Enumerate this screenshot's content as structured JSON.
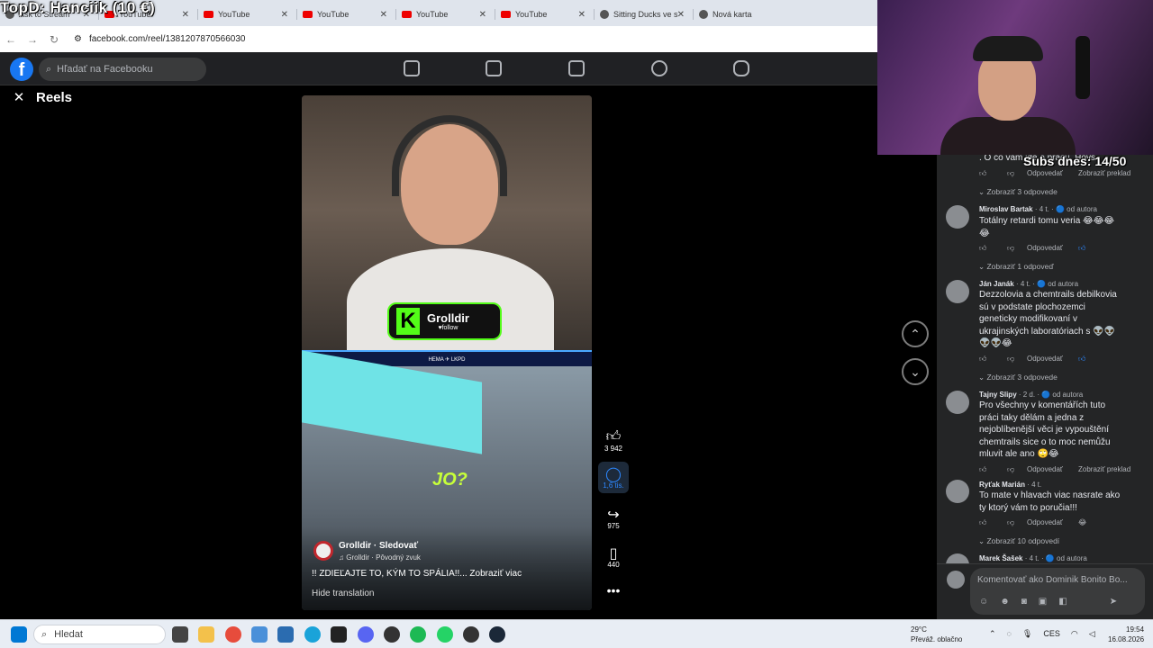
{
  "overlay_title": "TopD: Hanciik (10 €)",
  "tabs": [
    {
      "label": "Ask to Stream",
      "icon": "generic-icon"
    },
    {
      "label": "YouTube",
      "icon": "youtube-icon"
    },
    {
      "label": "YouTube",
      "icon": "youtube-icon"
    },
    {
      "label": "YouTube",
      "icon": "youtube-icon"
    },
    {
      "label": "YouTube",
      "icon": "youtube-icon"
    },
    {
      "label": "YouTube",
      "icon": "youtube-icon"
    },
    {
      "label": "Sitting Ducks ve s",
      "icon": "steam-icon"
    },
    {
      "label": "Nová karta",
      "icon": "chrome-icon"
    }
  ],
  "address": {
    "url": "facebook.com/reel/1381207870566030"
  },
  "facebook": {
    "search_placeholder": "Hľadať na Facebooku",
    "reels_title": "Reels"
  },
  "video": {
    "kick_name": "Grolldir",
    "kick_follow": "♥follow",
    "strip_text": "HEMA ✈ LKPD",
    "overlay_word": "JO?",
    "author": "Grolldir",
    "follow": "· Sledovať",
    "audio": "♫ Grolldir · Pôvodný zvuk",
    "caption": "!! ZDIEĽAJTE TO, KÝM TO SPÁLIA!!... Zobraziť viac",
    "hide_translation": "Hide translation"
  },
  "actions": {
    "likes": "3 942",
    "comments": "1,6 tis.",
    "shares": "975",
    "saves": "440"
  },
  "stream": {
    "subs": "Subs dnes: 14/50"
  },
  "comments": {
    "top_fragment": ". O co vám jde o prácu. Hovs",
    "top_actions": [
      "Odpovedať",
      "Zobraziť preklad"
    ],
    "view_replies_1": "Zobraziť 3 odpovede",
    "items": [
      {
        "name": "Miroslav Bartak",
        "meta": "· 4 t. · 🔵 od autora",
        "text": "Totálny retardi tomu veria 😂😂😂😂",
        "reply": "Odpovedať",
        "extra": "",
        "view": "Zobraziť 1 odpoveď"
      },
      {
        "name": "Ján Janák",
        "meta": "· 4 t. · 🔵 od autora",
        "text": "Dezzolovia a chemtrails debilkovia sú v podstate plochozemci geneticky modifikovaní v ukrajinských laboratóriach s 👽👽👽👽😂",
        "reply": "Odpovedať",
        "extra": "",
        "view": "Zobraziť 3 odpovede"
      },
      {
        "name": "Tajny Slipy",
        "meta": "· 2 d. · 🔵 od autora",
        "text": "Pro všechny v komentářích tuto práci taky dělám a jedna z nejoblíbenější věci je vypouštění chemtrails sice o to moc nemůžu mluvit ale ano 🙄😂",
        "reply": "Odpovedať",
        "extra": "Zobraziť preklad",
        "view": ""
      },
      {
        "name": "Ryťak Marián",
        "meta": "· 4 t.",
        "text": "To mate v hlavach viac nasrate ako ty ktorý vám to poručia!!!",
        "reply": "Odpovedať",
        "extra": "",
        "view": "Zobraziť 10 odpovedí"
      },
      {
        "name": "Marek Šašek",
        "meta": "· 4 t. · 🔵 od autora",
        "text": "",
        "reply": "",
        "extra": "",
        "view": ""
      }
    ],
    "composer_placeholder": "Komentovať ako Dominik Bonito Bo..."
  },
  "taskbar": {
    "search": "Hledat",
    "weather_temp": "29°C",
    "weather_desc": "Převáž. oblačno",
    "lang": "CES",
    "time": "19:54",
    "date": "16.08.2026"
  }
}
